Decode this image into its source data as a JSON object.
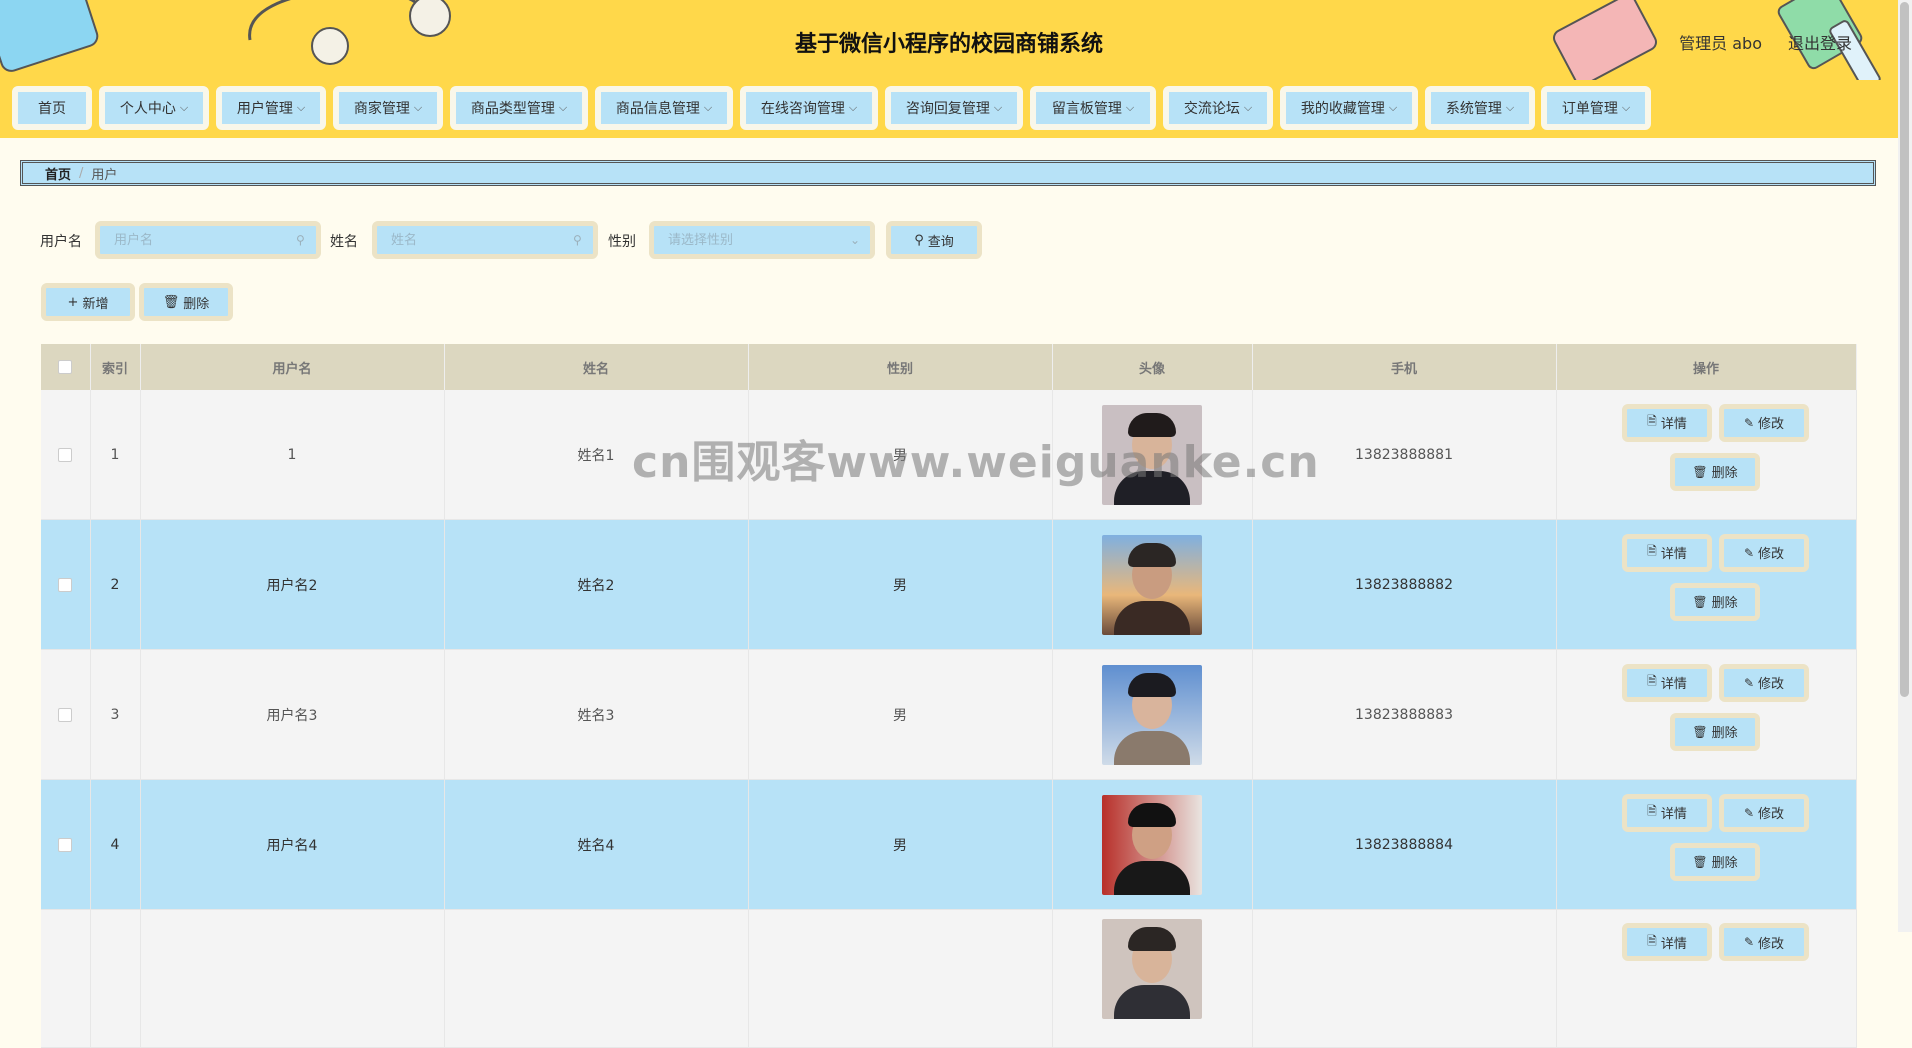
{
  "header": {
    "title": "基于微信小程序的校园商铺系统",
    "user": "管理员 abo",
    "logout": "退出登录"
  },
  "nav": [
    {
      "label": "首页",
      "has_menu": false
    },
    {
      "label": "个人中心",
      "has_menu": true
    },
    {
      "label": "用户管理",
      "has_menu": true
    },
    {
      "label": "商家管理",
      "has_menu": true
    },
    {
      "label": "商品类型管理",
      "has_menu": true
    },
    {
      "label": "商品信息管理",
      "has_menu": true
    },
    {
      "label": "在线咨询管理",
      "has_menu": true
    },
    {
      "label": "咨询回复管理",
      "has_menu": true
    },
    {
      "label": "留言板管理",
      "has_menu": true
    },
    {
      "label": "交流论坛",
      "has_menu": true
    },
    {
      "label": "我的收藏管理",
      "has_menu": true
    },
    {
      "label": "系统管理",
      "has_menu": true
    },
    {
      "label": "订单管理",
      "has_menu": true
    }
  ],
  "breadcrumb": {
    "home": "首页",
    "separator": "/",
    "current": "用户"
  },
  "search": {
    "username_label": "用户名",
    "username_placeholder": "用户名",
    "name_label": "姓名",
    "name_placeholder": "姓名",
    "gender_label": "性别",
    "gender_placeholder": "请选择性别",
    "query_button": "查询"
  },
  "actions": {
    "add": "新增",
    "delete": "删除"
  },
  "table": {
    "columns": [
      "索引",
      "用户名",
      "姓名",
      "性别",
      "头像",
      "手机",
      "操作"
    ],
    "row_actions": {
      "detail": "详情",
      "edit": "修改",
      "delete": "删除"
    },
    "rows": [
      {
        "index": "1",
        "username": "1",
        "name": "姓名1",
        "gender": "男",
        "phone": "13823888881"
      },
      {
        "index": "2",
        "username": "用户名2",
        "name": "姓名2",
        "gender": "男",
        "phone": "13823888882"
      },
      {
        "index": "3",
        "username": "用户名3",
        "name": "姓名3",
        "gender": "男",
        "phone": "13823888883"
      },
      {
        "index": "4",
        "username": "用户名4",
        "name": "姓名4",
        "gender": "男",
        "phone": "13823888884"
      },
      {
        "index": "",
        "username": "",
        "name": "",
        "gender": "",
        "phone": ""
      }
    ]
  },
  "watermark": "cn围观客www.weiguanke.cn",
  "icons": {
    "search": "search-icon",
    "dropdown": "chevron-down-icon",
    "add": "plus-icon",
    "delete": "trash-icon",
    "detail": "document-icon",
    "edit": "pencil-icon"
  },
  "colors": {
    "header_bg": "#ffd84a",
    "button_bg": "#b7e2f7",
    "button_border": "#ece3c6",
    "table_header_bg": "#dcd7c0",
    "page_bg": "#fffcef"
  }
}
